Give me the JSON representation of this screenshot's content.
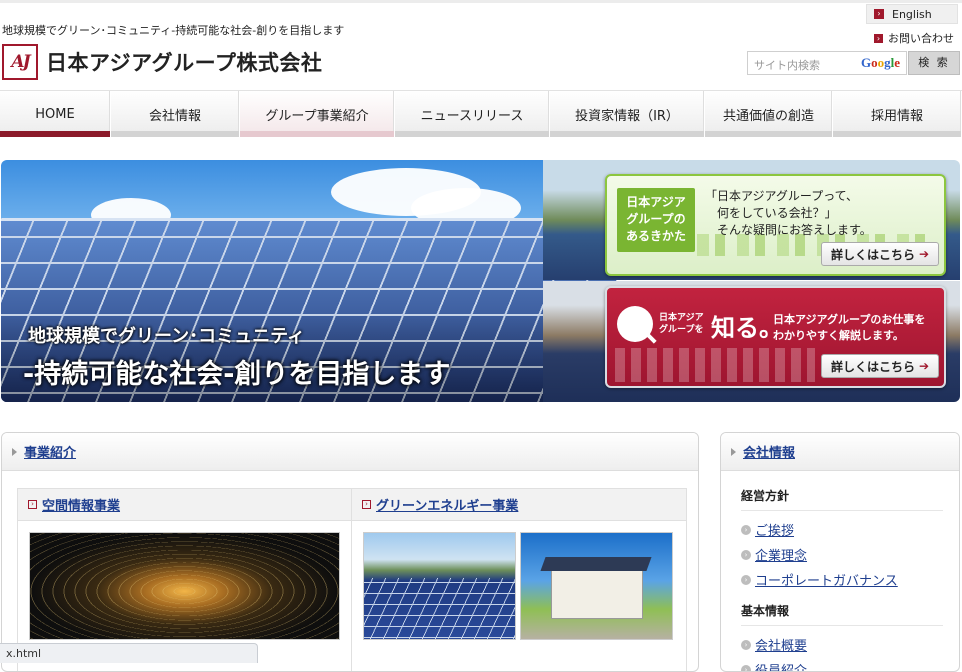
{
  "header": {
    "tagline": "地球規模でグリーン･コミュニティ-持続可能な社会-創りを目指します",
    "logo_mark": "AJ",
    "company_name": "日本アジアグループ株式会社",
    "lang_label": "English",
    "contact_label": "お問い合わせ",
    "search_placeholder": "サイト内検索",
    "search_brand": "Google",
    "search_button": "検 索"
  },
  "nav": {
    "items": [
      {
        "label": "HOME"
      },
      {
        "label": "会社情報"
      },
      {
        "label": "グループ事業紹介"
      },
      {
        "label": "ニュースリリース"
      },
      {
        "label": "投資家情報（IR）"
      },
      {
        "label": "共通価値の創造"
      },
      {
        "label": "採用情報"
      }
    ],
    "active_index": 0,
    "hover_index": 2
  },
  "hero": {
    "line1": "地球規模でグリーン･コミュニティ",
    "line2": "-持続可能な社会-創りを目指します",
    "card_green": {
      "badge": [
        "日本アジア",
        "グループの",
        "あるきかた"
      ],
      "text": [
        "「日本アジアグループって、",
        "　何をしている会社？」",
        "　そんな疑問にお答えします。"
      ],
      "button": "詳しくはこちら"
    },
    "card_red": {
      "small": [
        "日本アジア",
        "グループを"
      ],
      "big": "知る。",
      "text": [
        "日本アジアグループのお仕事を",
        "わかりやすく解説します。"
      ],
      "button": "詳しくはこちら"
    }
  },
  "business": {
    "title": "事業紹介",
    "columns": [
      {
        "title": "空間情報事業"
      },
      {
        "title": "グリーンエネルギー事業"
      }
    ]
  },
  "company_info": {
    "title": "会社情報",
    "groups": [
      {
        "heading": "経営方針",
        "links": [
          "ご挨拶",
          "企業理念",
          "コーポレートガバナンス"
        ]
      },
      {
        "heading": "基本情報",
        "links": [
          "会社概要",
          "役員紹介"
        ]
      }
    ]
  },
  "statusbar": {
    "text": "x.html"
  },
  "colors": {
    "brand": "#a0182c",
    "link": "#1f3f8f",
    "nav_active": "#8b1a2a",
    "green_card": "#8cc63f",
    "red_card": "#c2233f"
  },
  "icons": [
    "arrow-right-icon",
    "google-logo-icon",
    "triangle-right-icon",
    "circle-arrow-icon",
    "globe-search-icon"
  ]
}
